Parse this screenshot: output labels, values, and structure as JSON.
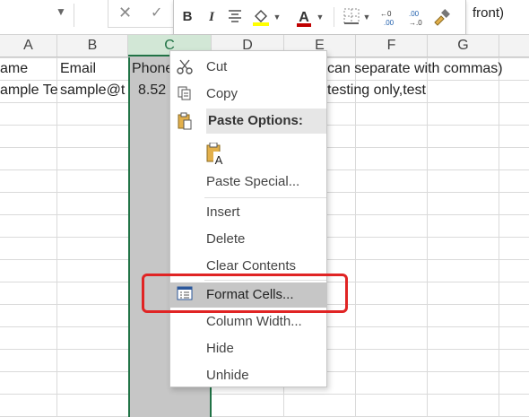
{
  "formula_bar": {
    "text": "front)",
    "cancel_glyph": "✕",
    "enter_glyph": "✓"
  },
  "mini_toolbar": {
    "bold": "B",
    "italic": "I",
    "font_color_letter": "A",
    "increase_decimal": ".00",
    "decrease_decimal": ".0",
    "fill_color": "#ffff00",
    "font_color": "#c00000"
  },
  "columns": [
    "A",
    "B",
    "C",
    "D",
    "E",
    "F",
    "G"
  ],
  "selected_column": "C",
  "cells": {
    "a1": "ame",
    "b1": "Email",
    "c1": "Phone",
    "e1": "can separate with commas)",
    "a2": "ample Te",
    "b2": "sample@t",
    "c2": "8.52",
    "e2": "testing only,test"
  },
  "context_menu": {
    "cut": "Cut",
    "copy": "Copy",
    "paste_options": "Paste Options:",
    "paste_special": "Paste Special...",
    "insert": "Insert",
    "delete": "Delete",
    "clear_contents": "Clear Contents",
    "format_cells": "Format Cells...",
    "column_width": "Column Width...",
    "hide": "Hide",
    "unhide": "Unhide"
  },
  "colors": {
    "accent_green": "#217346",
    "highlight_red": "#e02424",
    "selection_gray": "#c6c6c6"
  }
}
